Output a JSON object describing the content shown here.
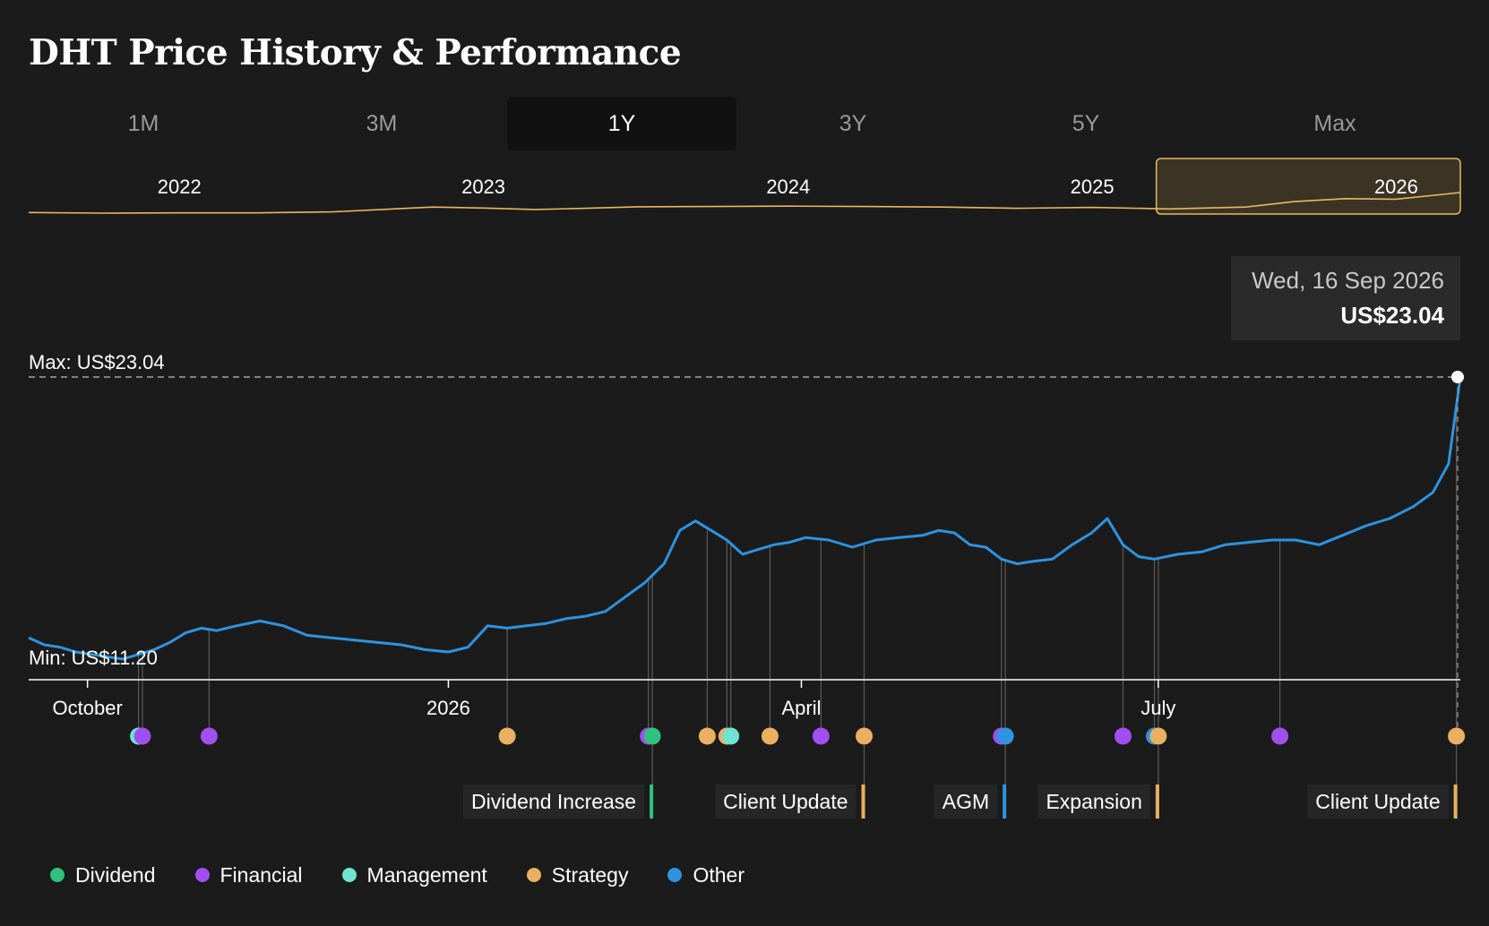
{
  "title": "DHT Price History & Performance",
  "tabs": [
    {
      "label": "1M",
      "active": false
    },
    {
      "label": "3M",
      "active": false
    },
    {
      "label": "1Y",
      "active": true
    },
    {
      "label": "3Y",
      "active": false
    },
    {
      "label": "5Y",
      "active": false
    },
    {
      "label": "Max",
      "active": false
    }
  ],
  "tooltip": {
    "date": "Wed, 16 Sep 2026",
    "price": "US$23.04"
  },
  "colors": {
    "background": "#1b1b1b",
    "line": "#2e93e0",
    "overview_line": "#e8b860",
    "dividend": "#2ec27e",
    "financial": "#a14ff0",
    "management": "#6fe3d1",
    "strategy": "#e8b060",
    "other": "#2e93e0"
  },
  "legend": [
    {
      "label": "Dividend",
      "color": "#2ec27e",
      "icon": "dividend-dot-icon"
    },
    {
      "label": "Financial",
      "color": "#a14ff0",
      "icon": "financial-dot-icon"
    },
    {
      "label": "Management",
      "color": "#6fe3d1",
      "icon": "management-dot-icon"
    },
    {
      "label": "Strategy",
      "color": "#e8b060",
      "icon": "strategy-dot-icon"
    },
    {
      "label": "Other",
      "color": "#2e93e0",
      "icon": "other-dot-icon"
    }
  ],
  "chart_data": {
    "type": "line",
    "overview": {
      "year_labels": [
        "2022",
        "2023",
        "2024",
        "2025",
        "2026"
      ],
      "range": [
        "2022-01-01",
        "2026-09-16"
      ],
      "selected_range": [
        "2025-09-16",
        "2026-09-16"
      ],
      "series": [
        [
          "2022-01-01",
          11.0
        ],
        [
          "2022-04-01",
          10.8
        ],
        [
          "2022-07-01",
          10.9
        ],
        [
          "2022-10-01",
          10.9
        ],
        [
          "2023-01-01",
          11.2
        ],
        [
          "2023-03-01",
          12.0
        ],
        [
          "2023-05-01",
          12.8
        ],
        [
          "2023-07-01",
          12.5
        ],
        [
          "2023-09-01",
          12.0
        ],
        [
          "2023-11-01",
          12.4
        ],
        [
          "2024-01-01",
          12.9
        ],
        [
          "2024-04-01",
          13.0
        ],
        [
          "2024-07-01",
          13.1
        ],
        [
          "2024-10-01",
          13.0
        ],
        [
          "2025-01-01",
          12.8
        ],
        [
          "2025-04-01",
          12.4
        ],
        [
          "2025-07-01",
          12.7
        ],
        [
          "2025-10-01",
          12.2
        ],
        [
          "2026-01-01",
          12.8
        ],
        [
          "2026-03-01",
          14.6
        ],
        [
          "2026-05-01",
          15.6
        ],
        [
          "2026-07-01",
          15.4
        ],
        [
          "2026-09-16",
          17.6
        ]
      ]
    },
    "x_ticks": [
      {
        "label": "October",
        "date": "2025-10-01"
      },
      {
        "label": "2026",
        "date": "2026-01-01"
      },
      {
        "label": "April",
        "date": "2026-04-01"
      },
      {
        "label": "July",
        "date": "2026-07-01"
      }
    ],
    "x_range": [
      "2025-09-16",
      "2026-09-16"
    ],
    "max_label": "Max: US$23.04",
    "min_label": "Min: US$11.20",
    "max": 23.04,
    "min": 11.2,
    "series": [
      {
        "values": [
          [
            "2025-09-16",
            12.1
          ],
          [
            "2025-09-20",
            11.8
          ],
          [
            "2025-09-24",
            11.7
          ],
          [
            "2025-09-28",
            11.5
          ],
          [
            "2025-10-02",
            11.4
          ],
          [
            "2025-10-06",
            11.3
          ],
          [
            "2025-10-10",
            11.2
          ],
          [
            "2025-10-14",
            11.4
          ],
          [
            "2025-10-18",
            11.6
          ],
          [
            "2025-10-22",
            11.9
          ],
          [
            "2025-10-26",
            12.3
          ],
          [
            "2025-10-30",
            12.5
          ],
          [
            "2025-11-03",
            12.4
          ],
          [
            "2025-11-08",
            12.6
          ],
          [
            "2025-11-14",
            12.8
          ],
          [
            "2025-11-20",
            12.6
          ],
          [
            "2025-11-26",
            12.2
          ],
          [
            "2025-12-02",
            12.1
          ],
          [
            "2025-12-08",
            12.0
          ],
          [
            "2025-12-14",
            11.9
          ],
          [
            "2025-12-20",
            11.8
          ],
          [
            "2025-12-26",
            11.6
          ],
          [
            "2026-01-01",
            11.5
          ],
          [
            "2026-01-06",
            11.7
          ],
          [
            "2026-01-11",
            12.6
          ],
          [
            "2026-01-16",
            12.5
          ],
          [
            "2026-01-21",
            12.6
          ],
          [
            "2026-01-26",
            12.7
          ],
          [
            "2026-01-31",
            12.9
          ],
          [
            "2026-02-05",
            13.0
          ],
          [
            "2026-02-10",
            13.2
          ],
          [
            "2026-02-15",
            13.8
          ],
          [
            "2026-02-20",
            14.4
          ],
          [
            "2026-02-25",
            15.2
          ],
          [
            "2026-03-01",
            16.6
          ],
          [
            "2026-03-05",
            17.0
          ],
          [
            "2026-03-09",
            16.6
          ],
          [
            "2026-03-13",
            16.2
          ],
          [
            "2026-03-17",
            15.6
          ],
          [
            "2026-03-21",
            15.8
          ],
          [
            "2026-03-25",
            16.0
          ],
          [
            "2026-03-29",
            16.1
          ],
          [
            "2026-04-02",
            16.3
          ],
          [
            "2026-04-08",
            16.2
          ],
          [
            "2026-04-14",
            15.9
          ],
          [
            "2026-04-20",
            16.2
          ],
          [
            "2026-04-26",
            16.3
          ],
          [
            "2026-05-02",
            16.4
          ],
          [
            "2026-05-06",
            16.6
          ],
          [
            "2026-05-10",
            16.5
          ],
          [
            "2026-05-14",
            16.0
          ],
          [
            "2026-05-18",
            15.9
          ],
          [
            "2026-05-22",
            15.4
          ],
          [
            "2026-05-26",
            15.2
          ],
          [
            "2026-05-30",
            15.3
          ],
          [
            "2026-06-04",
            15.4
          ],
          [
            "2026-06-09",
            16.0
          ],
          [
            "2026-06-14",
            16.5
          ],
          [
            "2026-06-18",
            17.1
          ],
          [
            "2026-06-22",
            16.0
          ],
          [
            "2026-06-26",
            15.5
          ],
          [
            "2026-06-30",
            15.4
          ],
          [
            "2026-07-06",
            15.6
          ],
          [
            "2026-07-12",
            15.7
          ],
          [
            "2026-07-18",
            16.0
          ],
          [
            "2026-07-24",
            16.1
          ],
          [
            "2026-07-30",
            16.2
          ],
          [
            "2026-08-05",
            16.2
          ],
          [
            "2026-08-11",
            16.0
          ],
          [
            "2026-08-17",
            16.4
          ],
          [
            "2026-08-23",
            16.8
          ],
          [
            "2026-08-29",
            17.1
          ],
          [
            "2026-09-04",
            17.6
          ],
          [
            "2026-09-09",
            18.2
          ],
          [
            "2026-09-13",
            19.4
          ],
          [
            "2026-09-16",
            23.04
          ]
        ]
      }
    ],
    "events": [
      {
        "date": "2025-10-14",
        "category": "management",
        "label": ""
      },
      {
        "date": "2025-10-15",
        "category": "financial",
        "label": ""
      },
      {
        "date": "2025-11-01",
        "category": "financial",
        "label": ""
      },
      {
        "date": "2026-01-16",
        "category": "strategy",
        "label": ""
      },
      {
        "date": "2026-02-21",
        "category": "financial",
        "label": ""
      },
      {
        "date": "2026-02-22",
        "category": "dividend",
        "label": "Dividend Increase"
      },
      {
        "date": "2026-03-08",
        "category": "strategy",
        "label": ""
      },
      {
        "date": "2026-03-13",
        "category": "strategy",
        "label": ""
      },
      {
        "date": "2026-03-14",
        "category": "management",
        "label": ""
      },
      {
        "date": "2026-03-24",
        "category": "strategy",
        "label": ""
      },
      {
        "date": "2026-04-06",
        "category": "financial",
        "label": ""
      },
      {
        "date": "2026-04-17",
        "category": "strategy",
        "label": "Client Update"
      },
      {
        "date": "2026-05-22",
        "category": "financial",
        "label": ""
      },
      {
        "date": "2026-05-23",
        "category": "other",
        "label": "AGM"
      },
      {
        "date": "2026-06-22",
        "category": "financial",
        "label": ""
      },
      {
        "date": "2026-06-30",
        "category": "other",
        "label": ""
      },
      {
        "date": "2026-07-01",
        "category": "strategy",
        "label": "Expansion"
      },
      {
        "date": "2026-08-01",
        "category": "financial",
        "label": ""
      },
      {
        "date": "2026-09-15",
        "category": "strategy",
        "label": "Client Update"
      }
    ]
  }
}
